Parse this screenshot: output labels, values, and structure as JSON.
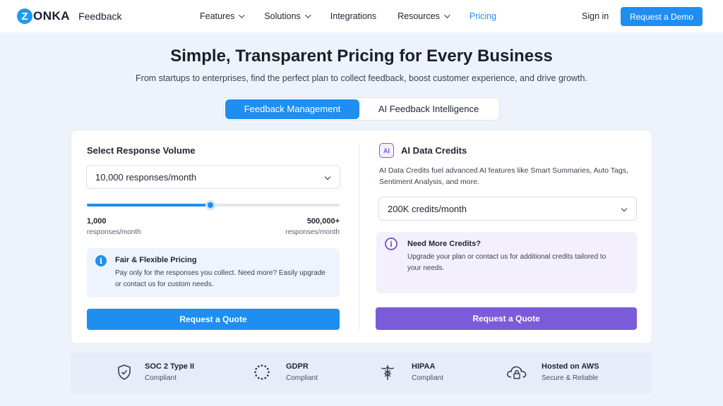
{
  "header": {
    "logo_mark": "Z",
    "logo_text": "ONKA",
    "product": "Feedback",
    "nav": [
      {
        "label": "Features",
        "has_dropdown": true
      },
      {
        "label": "Solutions",
        "has_dropdown": true
      },
      {
        "label": "Integrations",
        "has_dropdown": false
      },
      {
        "label": "Resources",
        "has_dropdown": true
      },
      {
        "label": "Pricing",
        "has_dropdown": false,
        "active": true
      }
    ],
    "sign_in": "Sign in",
    "demo_button": "Request a Demo"
  },
  "hero": {
    "title": "Simple, Transparent Pricing for Every Business",
    "subtitle": "From startups to enterprises, find the perfect plan to collect feedback, boost customer experience, and drive growth."
  },
  "tabs": [
    {
      "label": "Feedback Management",
      "active": true
    },
    {
      "label": "AI Feedback Intelligence",
      "active": false
    }
  ],
  "left": {
    "label": "Select Response Volume",
    "selected": "10,000 responses/month",
    "slider": {
      "level": 0.49
    },
    "min_value": "1,000",
    "min_unit": "responses/month",
    "max_value": "500,000+",
    "max_unit": "responses/month",
    "info_icon": "i",
    "info_title": "Fair & Flexible Pricing",
    "info_text": "Pay only for the responses you collect. Need more? Easily upgrade or contact us for custom needs.",
    "button": "Request a Quote"
  },
  "right": {
    "badge": "AI",
    "label": "AI Data Credits",
    "description": "AI Data Credits fuel advanced AI features like Smart Summaries, Auto Tags, Sentiment Analysis, and more.",
    "selected": "200K credits/month",
    "info_icon": "i",
    "box_title": "Need More Credits?",
    "box_text": "Upgrade your plan or contact us for additional credits tailored to your needs.",
    "button": "Request a Quote"
  },
  "compliance": [
    {
      "icon": "shield-check-icon",
      "title": "SOC 2 Type II",
      "sub": "Compliant"
    },
    {
      "icon": "eu-stars-icon",
      "title": "GDPR",
      "sub": "Compliant"
    },
    {
      "icon": "caduceus-icon",
      "title": "HIPAA",
      "sub": "Compliant"
    },
    {
      "icon": "cloud-lock-icon",
      "title": "Hosted on AWS",
      "sub": "Secure & Reliable"
    }
  ],
  "colors": {
    "primary": "#1e8ff0",
    "purple": "#7a5bd8",
    "background": "#eef3fb"
  }
}
